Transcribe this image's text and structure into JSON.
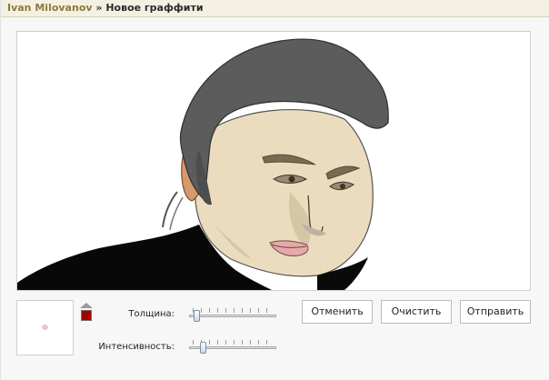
{
  "header": {
    "user": "Ivan Milovanov",
    "separator": "»",
    "page": "Новое граффити"
  },
  "controls": {
    "thickness_label": "Толщина:",
    "intensity_label": "Интенсивность:",
    "thickness_level": 0.06,
    "intensity_level": 0.14,
    "brush_color": "#a40000",
    "brush_preview_color": "#f1c4c7"
  },
  "buttons": {
    "cancel": "Отменить",
    "clear": "Очистить",
    "send": "Отправить"
  },
  "colors": {
    "header_bg": "#f4f1e3",
    "page_bg": "#f7f7f7"
  }
}
